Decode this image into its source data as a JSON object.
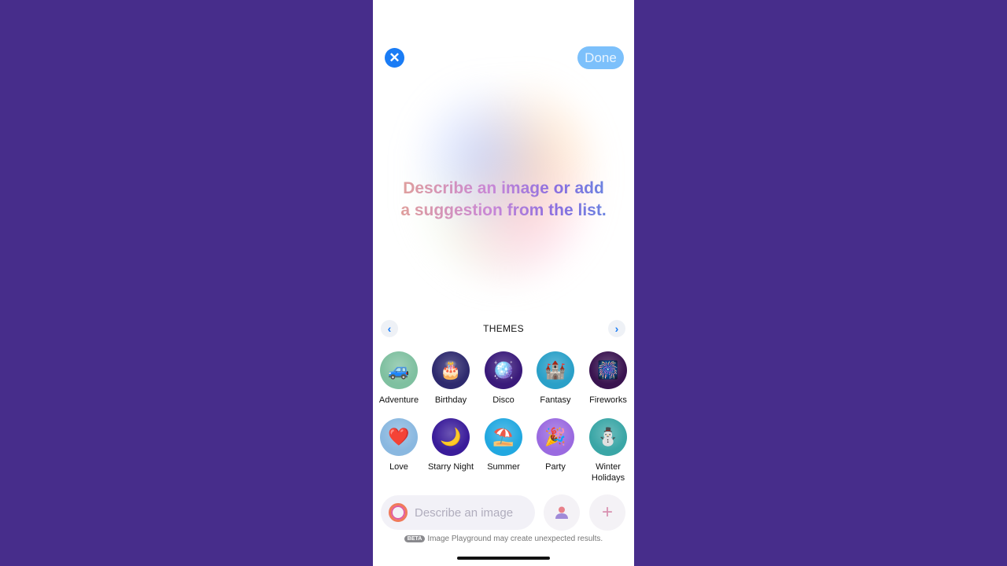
{
  "header": {
    "close_icon": "xmark-icon",
    "done_label": "Done"
  },
  "prompt": {
    "line1": "Describe an image or add",
    "line2": "a suggestion from the list."
  },
  "themes": {
    "title": "THEMES",
    "items": [
      {
        "label": "Adventure",
        "emoji": "🚙",
        "bg": "#7fc0a0"
      },
      {
        "label": "Birthday",
        "emoji": "🎂",
        "bg": "#2e2a6e"
      },
      {
        "label": "Disco",
        "emoji": "🪩",
        "bg": "#3a1a7a"
      },
      {
        "label": "Fantasy",
        "emoji": "🏰",
        "bg": "#2aa0c8"
      },
      {
        "label": "Fireworks",
        "emoji": "🎆",
        "bg": "#3a1450"
      },
      {
        "label": "Love",
        "emoji": "❤️",
        "bg": "#8ab8e0"
      },
      {
        "label": "Starry Night",
        "emoji": "🌙",
        "bg": "#3a1c9a"
      },
      {
        "label": "Summer",
        "emoji": "⛱️",
        "bg": "#22a8e0"
      },
      {
        "label": "Party",
        "emoji": "🎉",
        "bg": "#9a6ae0"
      },
      {
        "label": "Winter Holidays",
        "emoji": "⛄",
        "bg": "#3aa6a6"
      }
    ]
  },
  "input": {
    "placeholder": "Describe an image"
  },
  "disclaimer": {
    "badge": "BETA",
    "text": "Image Playground may create unexpected results."
  }
}
